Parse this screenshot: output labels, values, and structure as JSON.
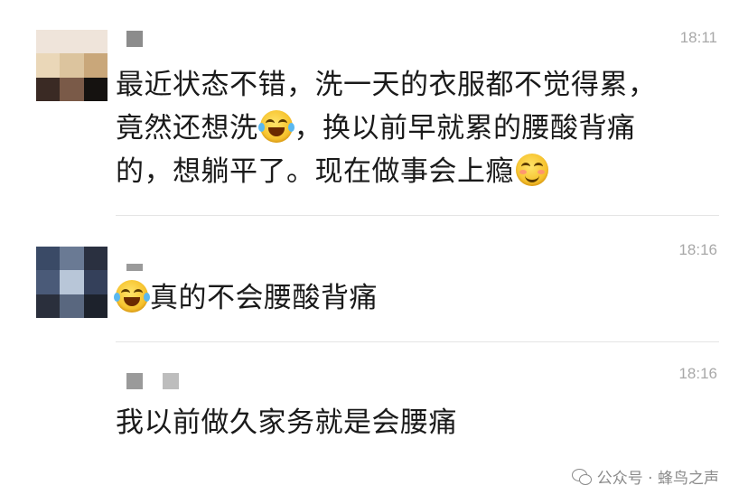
{
  "messages": [
    {
      "time": "18:11",
      "text_line1": "最近状态不错，洗一天的衣服都不觉得累，",
      "text_line2_a": "竟然还想洗",
      "text_line2_b": "，换以前早就累的腰酸背痛",
      "text_line3": "的，想躺平了。现在做事会上瘾"
    },
    {
      "time": "18:16",
      "text": "真的不会腰酸背痛"
    },
    {
      "time": "18:16",
      "text": "我以前做久家务就是会腰痛"
    }
  ],
  "icons": {
    "emoji_1": "laugh-cry-emoji-icon",
    "emoji_2": "smile-emoji-icon",
    "emoji_3": "laugh-cry-emoji-icon",
    "footer": "wechat-icon"
  },
  "footer": {
    "text": "公众号 · 蜂鸟之声"
  },
  "colors": {
    "text": "#1a1a1a",
    "time": "#a8a8a8",
    "divider": "#e4e4e4",
    "emoji": "#f7c531"
  }
}
